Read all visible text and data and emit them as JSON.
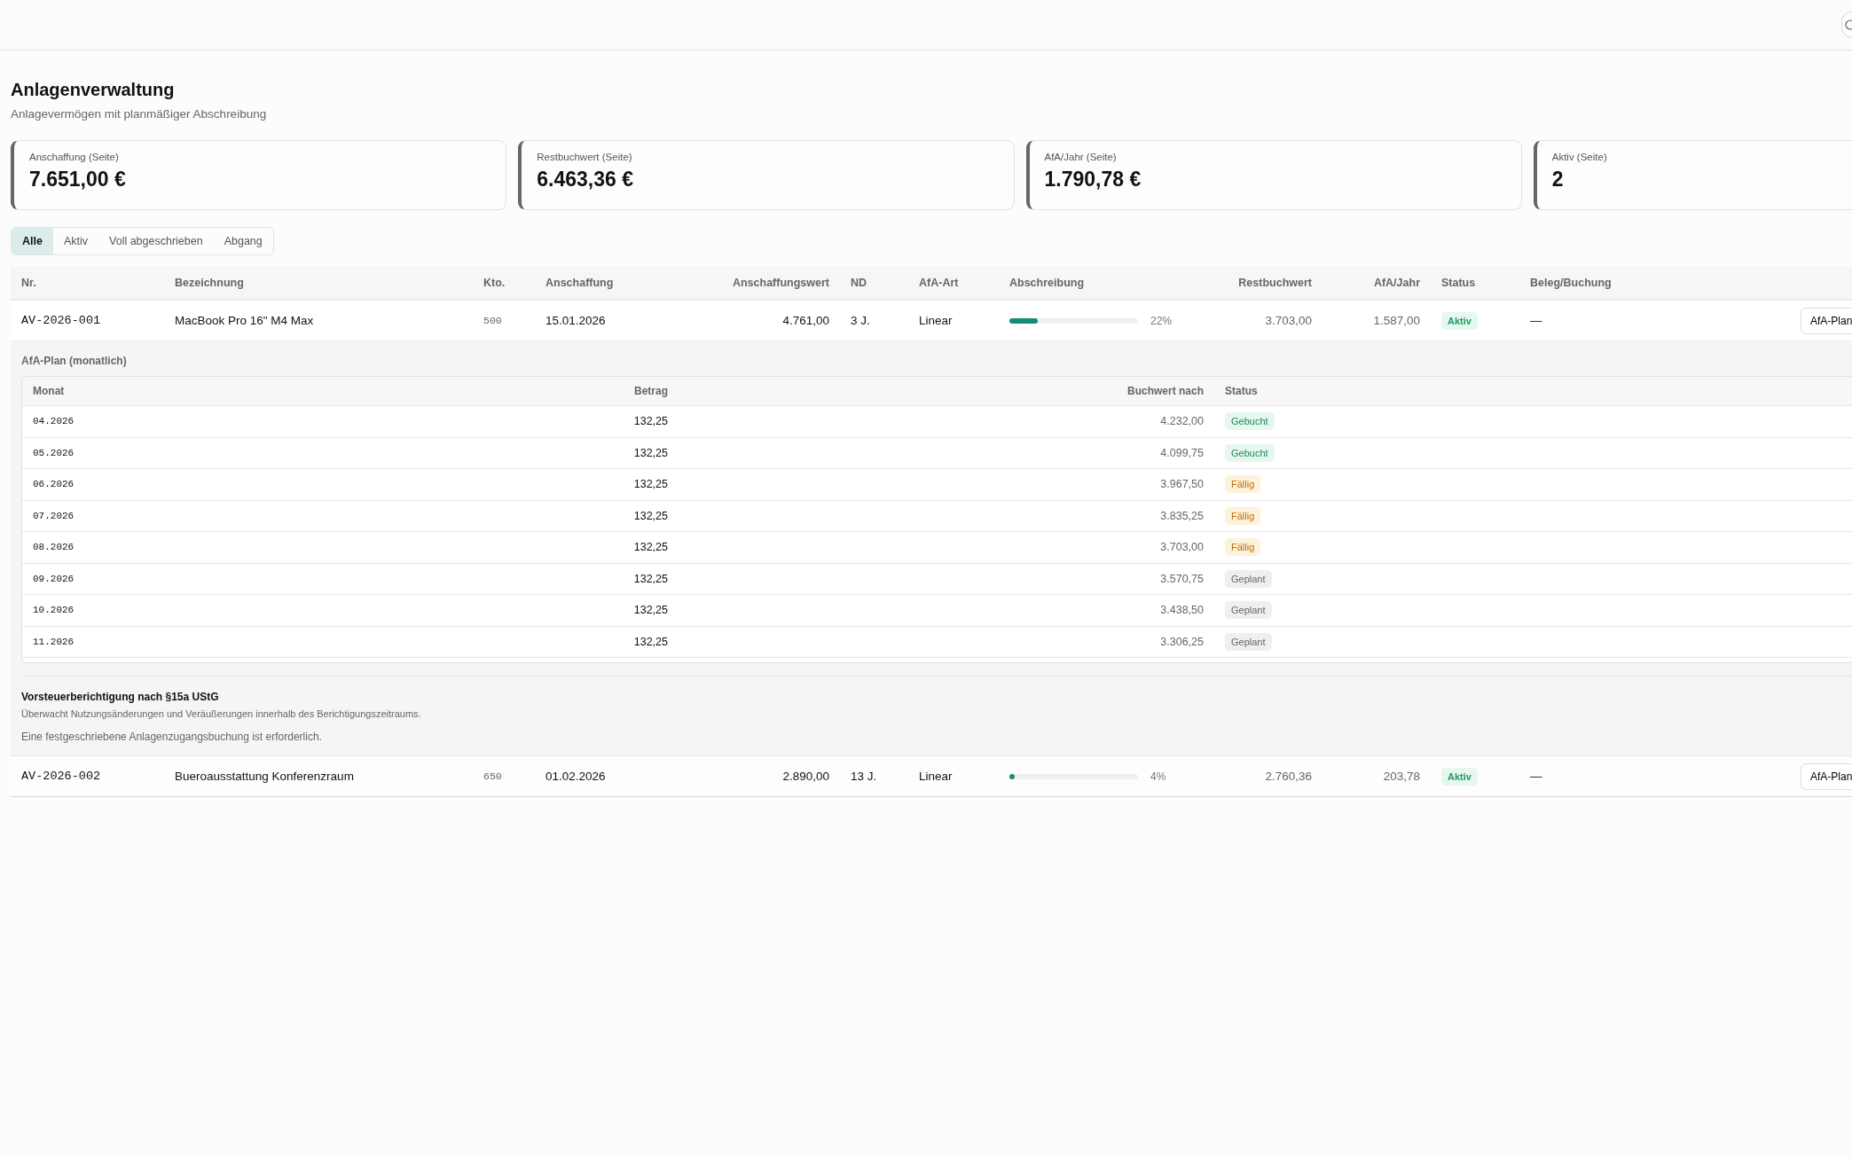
{
  "page": {
    "title": "Anlagenverwaltung",
    "subtitle": "Anlagevermögen mit planmäßiger Abschreibung"
  },
  "cards": [
    {
      "label": "Anschaffung (Seite)",
      "value": "7.651,00 €"
    },
    {
      "label": "Restbuchwert (Seite)",
      "value": "6.463,36 €"
    },
    {
      "label": "AfA/Jahr (Seite)",
      "value": "1.790,78 €"
    },
    {
      "label": "Aktiv (Seite)",
      "value": "2"
    }
  ],
  "tabs": [
    {
      "label": "Alle",
      "selected": true
    },
    {
      "label": "Aktiv",
      "selected": false
    },
    {
      "label": "Voll abgeschrieben",
      "selected": false
    },
    {
      "label": "Abgang",
      "selected": false
    }
  ],
  "table": {
    "columns": [
      "Nr.",
      "Bezeichnung",
      "Kto.",
      "Anschaffung",
      "Anschaffungswert",
      "ND",
      "AfA-Art",
      "Abschreibung",
      "Restbuchwert",
      "AfA/Jahr",
      "Status",
      "Beleg/Buchung"
    ],
    "rows": [
      {
        "nr": "AV-2026-001",
        "name": "MacBook Pro 16\" M4 Max",
        "account": "500",
        "date": "15.01.2026",
        "cost": "4.761,00",
        "life": "3 J.",
        "method": "Linear",
        "level": 0.22,
        "percent": "22%",
        "book_value": "3.703,00",
        "per_year": "1.587,00",
        "status": "Aktiv",
        "kind": "active",
        "voucher": "—",
        "action": "AfA-Plan",
        "expanded": true,
        "plan": {
          "title": "AfA-Plan (monatlich)",
          "columns": [
            "Monat",
            "Betrag",
            "Buchwert nach",
            "Status"
          ],
          "rows": [
            {
              "month": "04.2026",
              "amount": "132,25",
              "value_after": "4.232,00",
              "status": "Gebucht",
              "kind": "booked"
            },
            {
              "month": "05.2026",
              "amount": "132,25",
              "value_after": "4.099,75",
              "status": "Gebucht",
              "kind": "booked"
            },
            {
              "month": "06.2026",
              "amount": "132,25",
              "value_after": "3.967,50",
              "status": "Fällig",
              "kind": "due"
            },
            {
              "month": "07.2026",
              "amount": "132,25",
              "value_after": "3.835,25",
              "status": "Fällig",
              "kind": "due"
            },
            {
              "month": "08.2026",
              "amount": "132,25",
              "value_after": "3.703,00",
              "status": "Fällig",
              "kind": "due"
            },
            {
              "month": "09.2026",
              "amount": "132,25",
              "value_after": "3.570,75",
              "status": "Geplant",
              "kind": "planned"
            },
            {
              "month": "10.2026",
              "amount": "132,25",
              "value_after": "3.438,50",
              "status": "Geplant",
              "kind": "planned"
            },
            {
              "month": "11.2026",
              "amount": "132,25",
              "value_after": "3.306,25",
              "status": "Geplant",
              "kind": "planned"
            }
          ]
        },
        "vat": {
          "title": "Vorsteuerberichtigung nach §15a UStG",
          "description": "Überwacht Nutzungsänderungen und Veräußerungen innerhalb des Berichtigungszeitraums.",
          "note": "Eine festgeschriebene Anlagenzugangsbuchung ist erforderlich."
        }
      },
      {
        "nr": "AV-2026-002",
        "name": "Bueroausstattung Konferenzraum",
        "account": "650",
        "date": "01.02.2026",
        "cost": "2.890,00",
        "life": "13 J.",
        "method": "Linear",
        "level": 0.04,
        "percent": "4%",
        "book_value": "2.760,36",
        "per_year": "203,78",
        "status": "Aktiv",
        "kind": "active",
        "voucher": "—",
        "action": "AfA-Plan",
        "expanded": false
      }
    ]
  }
}
